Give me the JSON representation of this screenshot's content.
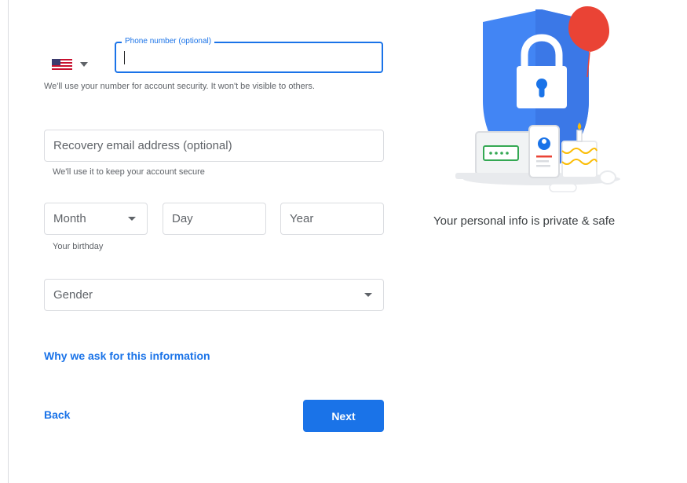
{
  "phone": {
    "label": "Phone number (optional)",
    "value": "",
    "helper": "We'll use your number for account security. It won't be visible to others.",
    "country_icon": "us-flag-icon"
  },
  "recovery": {
    "placeholder": "Recovery email address (optional)",
    "helper": "We'll use it to keep your account secure"
  },
  "birthday": {
    "month": "Month",
    "day": "Day",
    "year": "Year",
    "helper": "Your birthday"
  },
  "gender": {
    "placeholder": "Gender"
  },
  "links": {
    "why": "Why we ask for this information",
    "back": "Back"
  },
  "buttons": {
    "next": "Next"
  },
  "side": {
    "caption": "Your personal info is private & safe"
  },
  "colors": {
    "accent": "#1a73e8",
    "shield": "#4285f4",
    "balloon": "#ea4335"
  }
}
